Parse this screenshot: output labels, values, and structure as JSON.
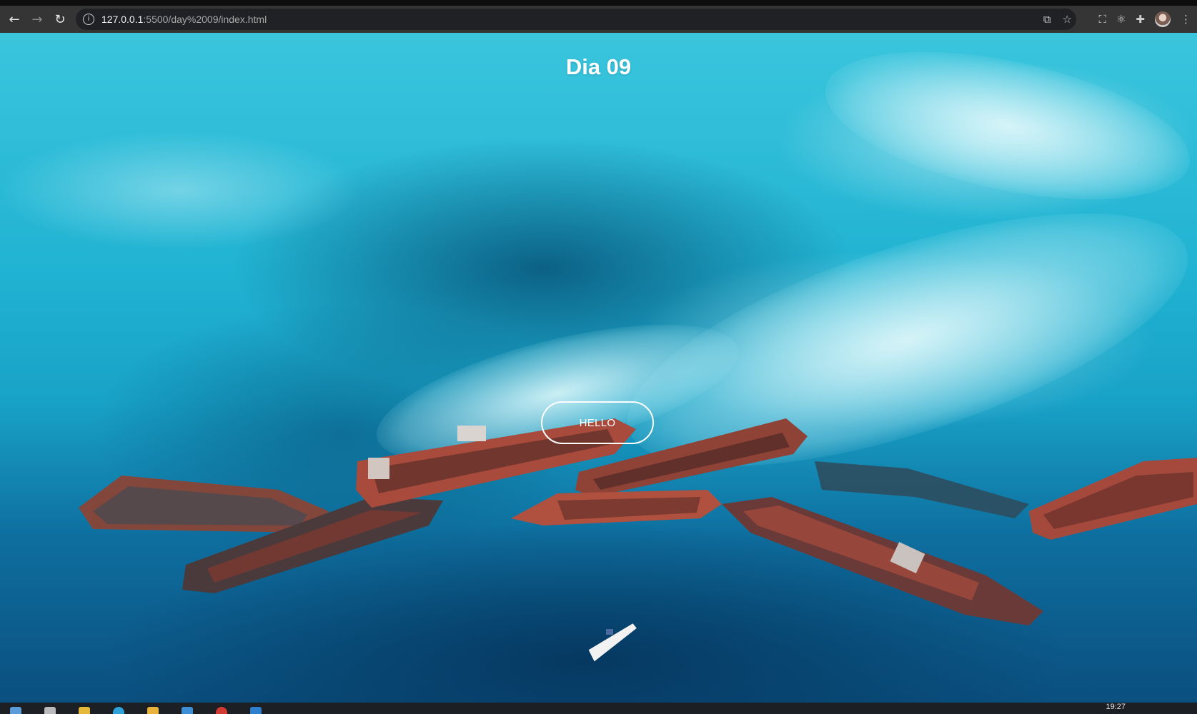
{
  "browser": {
    "url_host": "127.0.0.1",
    "url_path": ":5500/day%2009/index.html",
    "icons": [
      "back-icon",
      "forward-icon",
      "reload-icon",
      "info-icon",
      "translate-icon",
      "star-icon",
      "screenshot-icon",
      "react-devtools-icon",
      "extensions-icon",
      "profile-avatar",
      "menu-icon"
    ]
  },
  "page": {
    "title": "Dia 09",
    "button_label": "HELLO"
  },
  "taskbar": {
    "time": "19:27",
    "icons": [
      "windows-start-icon",
      "task-view-icon",
      "file-explorer-icon",
      "edge-icon",
      "app-icon",
      "vscode-like-icon",
      "chrome-icon",
      "vscode-icon"
    ]
  },
  "colors": {
    "chrome_bg": "#353535",
    "omnibox_bg": "#202124",
    "button_border": "#ffffff",
    "water_light": "#3ac5dd",
    "water_deep": "#0a4f7f",
    "wreck_rust": "#a84a3c"
  }
}
